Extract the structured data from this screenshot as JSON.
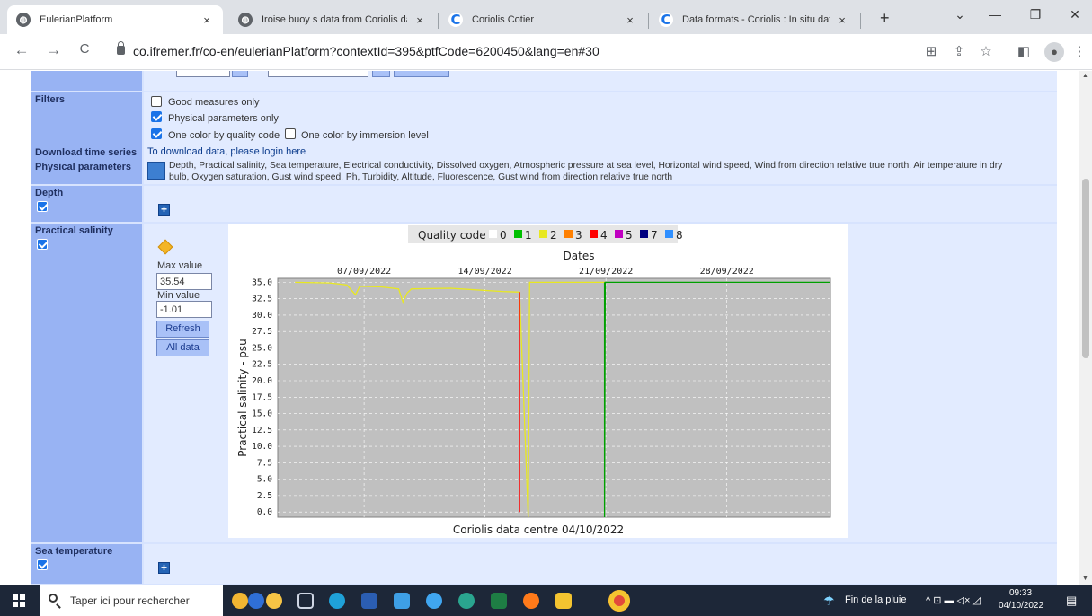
{
  "browser": {
    "tabs": [
      {
        "title": "EulerianPlatform",
        "close": "×"
      },
      {
        "title": "Iroise buoy s data from Coriolis data ce",
        "close": "×"
      },
      {
        "title": "Coriolis Cotier",
        "close": "×"
      },
      {
        "title": "Data formats - Coriolis : In situ data for",
        "close": "×"
      }
    ],
    "new_tab": "+",
    "window_controls": {
      "tabsearch": "⌄",
      "minimize": "—",
      "maximize": "❐",
      "close": "✕"
    },
    "nav": {
      "back": "←",
      "forward": "→",
      "reload": "C"
    },
    "url": "co.ifremer.fr/co-en/eulerianPlatform?contextId=395&ptfCode=6200450&lang=en#30",
    "toolbar_icons": {
      "translate": "⊞",
      "share": "⇪",
      "bookmark": "☆",
      "sidepanel": "◧",
      "menu": "⋮",
      "profile": "●"
    }
  },
  "page": {
    "filters": {
      "label": "Filters",
      "options": [
        {
          "label": "Good measures only",
          "checked": false
        },
        {
          "label": "Physical parameters only",
          "checked": true
        },
        {
          "label": "One color by quality code",
          "checked": true
        },
        {
          "label": "One color by immersion level",
          "checked": false
        }
      ]
    },
    "download": {
      "label": "Download time series",
      "text": "To download data, please login here"
    },
    "physical_parameters": {
      "label": "Physical parameters",
      "line1": "Depth, Practical salinity, Sea temperature, Electrical conductivity, Dissolved oxygen, Atmospheric pressure at sea level, Horizontal wind speed, Wind from direction relative true north, Air temperature in dry",
      "line2": "bulb, Oxygen saturation, Gust wind speed, Ph, Turbidity, Altitude, Fluorescence, Gust wind from direction relative true north"
    },
    "depth": {
      "label": "Depth",
      "checked": true,
      "expand": "+"
    },
    "salinity": {
      "label": "Practical salinity",
      "checked": true,
      "max_label": "Max value",
      "max_value": "35.54",
      "min_label": "Min value",
      "min_value": "-1.01",
      "refresh": "Refresh",
      "all_data": "All data"
    },
    "sea_temperature": {
      "label": "Sea temperature",
      "checked": true,
      "expand": "+"
    }
  },
  "chart_data": {
    "type": "line",
    "legend_title": "Quality code",
    "legend": [
      {
        "code": "0",
        "color": "#ffffff"
      },
      {
        "code": "1",
        "color": "#00c000"
      },
      {
        "code": "2",
        "color": "#e8e820"
      },
      {
        "code": "3",
        "color": "#ff8000"
      },
      {
        "code": "4",
        "color": "#ff0000"
      },
      {
        "code": "5",
        "color": "#c000c0"
      },
      {
        "code": "7",
        "color": "#000080"
      },
      {
        "code": "8",
        "color": "#3090ff"
      }
    ],
    "xlabel": "Dates",
    "ylabel": "Practical salinity - psu",
    "footer": "Coriolis data centre 04/10/2022",
    "x_ticks": [
      "07/09/2022",
      "14/09/2022",
      "21/09/2022",
      "28/09/2022"
    ],
    "y_ticks": [
      0.0,
      2.5,
      5.0,
      7.5,
      10.0,
      12.5,
      15.0,
      17.5,
      20.0,
      22.5,
      25.0,
      27.5,
      30.0,
      32.5,
      35.0
    ],
    "ylim": [
      -0.8,
      35.6
    ],
    "grid": true,
    "series": [
      {
        "color": "#e8e820",
        "points": [
          [
            "2022-09-03",
            35.0
          ],
          [
            "2022-09-05",
            34.9
          ],
          [
            "2022-09-06",
            34.6
          ],
          [
            "2022-09-06T12:00",
            33.1
          ],
          [
            "2022-09-06T18:00",
            34.4
          ],
          [
            "2022-09-08",
            34.3
          ],
          [
            "2022-09-09",
            34.0
          ],
          [
            "2022-09-09T06:00",
            32.0
          ],
          [
            "2022-09-09T12:00",
            33.4
          ],
          [
            "2022-09-09T18:00",
            34.0
          ],
          [
            "2022-09-12",
            34.1
          ],
          [
            "2022-09-15",
            33.6
          ],
          [
            "2022-09-16",
            33.5
          ],
          [
            "2022-09-16T12:00",
            -0.8
          ],
          [
            "2022-09-16T14:00",
            35.0
          ],
          [
            "2022-09-21",
            35.0
          ]
        ]
      },
      {
        "color": "#ff0000",
        "points": [
          [
            "2022-09-16T00:00",
            33.5
          ],
          [
            "2022-09-16T00:00",
            0.0
          ]
        ]
      },
      {
        "color": "#00a000",
        "points": [
          [
            "2022-09-20T22:00",
            35.0
          ],
          [
            "2022-09-20T22:00",
            -0.8
          ],
          [
            "2022-09-20T23:00",
            35.0
          ],
          [
            "2022-10-04",
            35.0
          ]
        ]
      }
    ]
  },
  "taskbar": {
    "search_placeholder": "Taper ici pour rechercher",
    "weather": "Fin de la pluie",
    "tray": "^ ⊡ ▬ ◁× ◿",
    "time": "09:33",
    "date": "04/10/2022"
  }
}
